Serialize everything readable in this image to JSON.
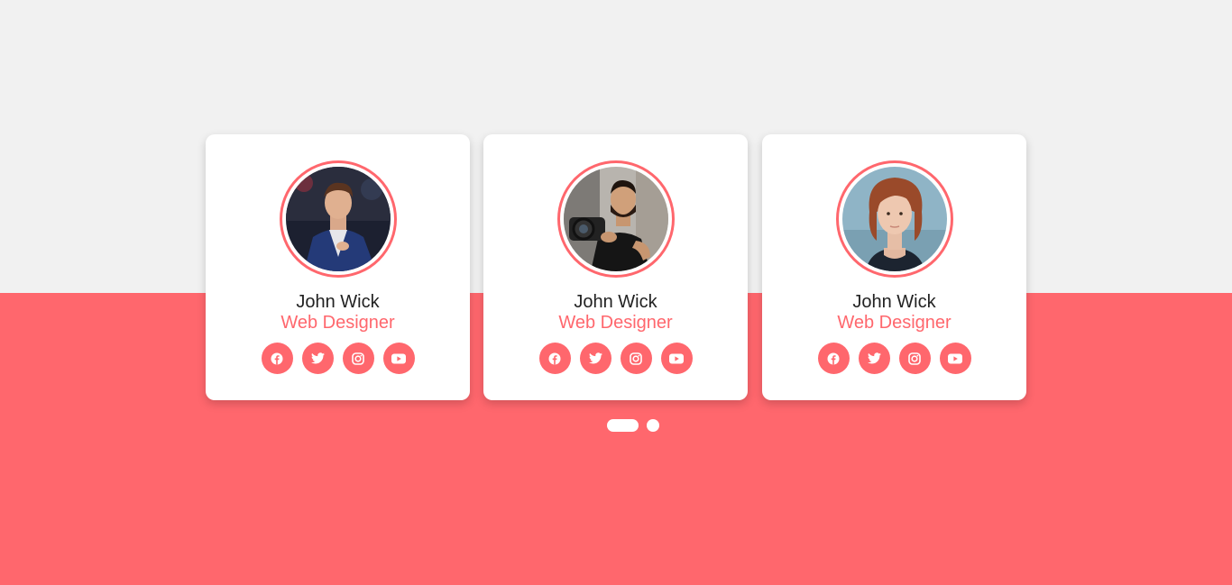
{
  "colors": {
    "accent": "#ff676d",
    "background_top": "#f1f1f1",
    "card": "#ffffff"
  },
  "team": {
    "members": [
      {
        "name": "John Wick",
        "role": "Web Designer",
        "socials": [
          "facebook-icon",
          "twitter-icon",
          "instagram-icon",
          "youtube-icon"
        ]
      },
      {
        "name": "John Wick",
        "role": "Web Designer",
        "socials": [
          "facebook-icon",
          "twitter-icon",
          "instagram-icon",
          "youtube-icon"
        ]
      },
      {
        "name": "John Wick",
        "role": "Web Designer",
        "socials": [
          "facebook-icon",
          "twitter-icon",
          "instagram-icon",
          "youtube-icon"
        ]
      }
    ]
  },
  "carousel": {
    "pages": 2,
    "active_page": 1
  }
}
